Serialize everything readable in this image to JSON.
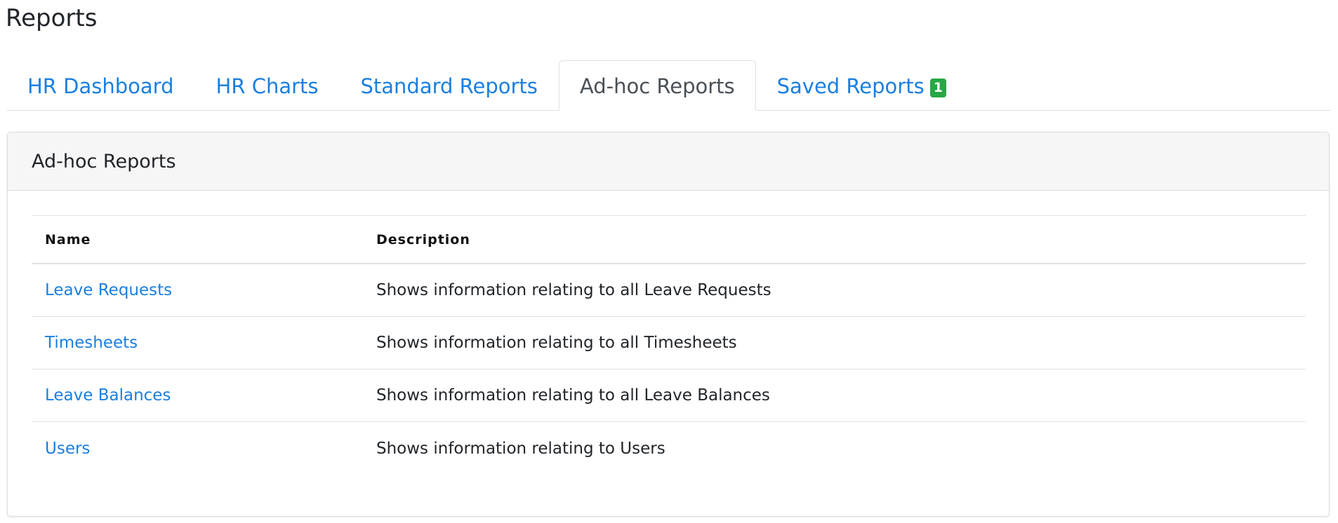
{
  "page": {
    "title": "Reports"
  },
  "tabs": [
    {
      "label": "HR Dashboard",
      "active": false
    },
    {
      "label": "HR Charts",
      "active": false
    },
    {
      "label": "Standard Reports",
      "active": false
    },
    {
      "label": "Ad-hoc Reports",
      "active": true
    },
    {
      "label": "Saved Reports",
      "active": false,
      "badge": "1"
    }
  ],
  "card": {
    "title": "Ad-hoc Reports"
  },
  "table": {
    "columns": [
      "Name",
      "Description"
    ],
    "rows": [
      {
        "name": "Leave Requests",
        "description": "Shows information relating to all Leave Requests"
      },
      {
        "name": "Timesheets",
        "description": "Shows information relating to all Timesheets"
      },
      {
        "name": "Leave Balances",
        "description": "Shows information relating to all Leave Balances"
      },
      {
        "name": "Users",
        "description": "Shows information relating to Users"
      }
    ]
  },
  "colors": {
    "link": "#1a7fe0",
    "active_tab_text": "#495057",
    "badge_bg": "#28a745",
    "card_header_bg": "#f6f6f6",
    "border": "#dee2e6"
  }
}
